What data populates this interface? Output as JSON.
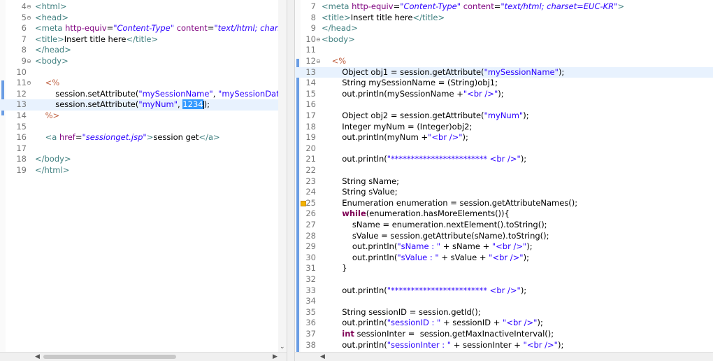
{
  "left_editor": {
    "lines": [
      {
        "num": "4",
        "fold": "⊖",
        "html": "<span class='tag'>&lt;html&gt;</span>"
      },
      {
        "num": "5",
        "fold": "⊖",
        "html": "<span class='tag'>&lt;head&gt;</span>"
      },
      {
        "num": "6",
        "fold": "",
        "html": "<span class='tag'>&lt;meta</span> <span class='attr'>http-equiv</span>=<span class='aval'>\"Content-Type\"</span> <span class='attr'>content</span>=<span class='aval'>\"text/html; charset</span>"
      },
      {
        "num": "7",
        "fold": "",
        "html": "<span class='tag'>&lt;title&gt;</span>Insert title here<span class='tag'>&lt;/title&gt;</span>"
      },
      {
        "num": "8",
        "fold": "",
        "html": "<span class='tag'>&lt;/head&gt;</span>"
      },
      {
        "num": "9",
        "fold": "⊖",
        "html": "<span class='tag'>&lt;body&gt;</span>"
      },
      {
        "num": "10",
        "fold": "",
        "html": ""
      },
      {
        "num": "11",
        "fold": "⊖",
        "html": "    <span class='jsp'>&lt;%</span>"
      },
      {
        "num": "12",
        "fold": "",
        "html": "        session.setAttribute(<span class='str'>\"mySessionName\"</span>, <span class='str'>\"mySessionData\"</span>)"
      },
      {
        "num": "13",
        "fold": "",
        "html": "        session.setAttribute(<span class='str'>\"myNum\"</span>, <span class='sel'>1234</span><span class='cursor'></span>);",
        "highlight": true
      },
      {
        "num": "14",
        "fold": "",
        "html": "    <span class='jsp'>%&gt;</span>"
      },
      {
        "num": "15",
        "fold": "",
        "html": ""
      },
      {
        "num": "16",
        "fold": "",
        "html": "    <span class='tag'>&lt;a</span> <span class='attr'>href</span>=<span class='aval'>\"sessionget.jsp\"</span><span class='tag'>&gt;</span>session get<span class='tag'>&lt;/a&gt;</span>"
      },
      {
        "num": "17",
        "fold": "",
        "html": ""
      },
      {
        "num": "18",
        "fold": "",
        "html": "<span class='tag'>&lt;/body&gt;</span>"
      },
      {
        "num": "19",
        "fold": "",
        "html": "<span class='tag'>&lt;/html&gt;</span>"
      }
    ]
  },
  "right_editor": {
    "lines": [
      {
        "num": "7",
        "fold": "",
        "html": "<span class='tag'>&lt;meta</span> <span class='attr'>http-equiv</span>=<span class='aval'>\"Content-Type\"</span> <span class='attr'>content</span>=<span class='aval'>\"text/html; charset=EUC-KR\"</span><span class='tag'>&gt;</span>"
      },
      {
        "num": "8",
        "fold": "",
        "html": "<span class='tag'>&lt;title&gt;</span>Insert title here<span class='tag'>&lt;/title&gt;</span>"
      },
      {
        "num": "9",
        "fold": "",
        "html": "<span class='tag'>&lt;/head&gt;</span>"
      },
      {
        "num": "10",
        "fold": "⊖",
        "html": "<span class='tag'>&lt;body&gt;</span>"
      },
      {
        "num": "11",
        "fold": "",
        "html": ""
      },
      {
        "num": "12",
        "fold": "⊖",
        "html": "    <span class='jsp'>&lt;%</span>"
      },
      {
        "num": "13",
        "fold": "",
        "html": "        Object obj1 = session.getAttribute(<span class='str'>\"mySessionName\"</span>);",
        "highlight": true
      },
      {
        "num": "14",
        "fold": "",
        "html": "        String mySessionName = (String)obj1;"
      },
      {
        "num": "15",
        "fold": "",
        "html": "        out.println(mySessionName +<span class='str'>\"&lt;br /&gt;\"</span>);"
      },
      {
        "num": "16",
        "fold": "",
        "html": ""
      },
      {
        "num": "17",
        "fold": "",
        "html": "        Object obj2 = session.getAttribute(<span class='str'>\"myNum\"</span>);"
      },
      {
        "num": "18",
        "fold": "",
        "html": "        Integer myNum = (Integer)obj2;"
      },
      {
        "num": "19",
        "fold": "",
        "html": "        out.println(myNum +<span class='str'>\"&lt;br /&gt;\"</span>);"
      },
      {
        "num": "20",
        "fold": "",
        "html": ""
      },
      {
        "num": "21",
        "fold": "",
        "html": "        out.println(<span class='str'>\"************************ &lt;br /&gt;\"</span>);"
      },
      {
        "num": "22",
        "fold": "",
        "html": ""
      },
      {
        "num": "23",
        "fold": "",
        "html": "        String sName;"
      },
      {
        "num": "24",
        "fold": "",
        "html": "        String sValue;"
      },
      {
        "num": "25",
        "fold": "",
        "html": "        Enumeration enumeration = session.getAttributeNames();",
        "warning": true
      },
      {
        "num": "26",
        "fold": "",
        "html": "        <span class='kw'>while</span>(enumeration.hasMoreElements()){"
      },
      {
        "num": "27",
        "fold": "",
        "html": "            sName = enumeration.nextElement().toString();"
      },
      {
        "num": "28",
        "fold": "",
        "html": "            sValue = session.getAttribute(sName).toString();"
      },
      {
        "num": "29",
        "fold": "",
        "html": "            out.println(<span class='str'>\"sName : \"</span> + sName + <span class='str'>\"&lt;br /&gt;\"</span>);"
      },
      {
        "num": "30",
        "fold": "",
        "html": "            out.println(<span class='str'>\"sValue : \"</span> + sValue + <span class='str'>\"&lt;br /&gt;\"</span>);"
      },
      {
        "num": "31",
        "fold": "",
        "html": "        }"
      },
      {
        "num": "32",
        "fold": "",
        "html": ""
      },
      {
        "num": "33",
        "fold": "",
        "html": "        out.println(<span class='str'>\"************************ &lt;br /&gt;\"</span>);"
      },
      {
        "num": "34",
        "fold": "",
        "html": ""
      },
      {
        "num": "35",
        "fold": "",
        "html": "        String sessionID = session.getId();"
      },
      {
        "num": "36",
        "fold": "",
        "html": "        out.println(<span class='str'>\"sessionID : \"</span> + sessionID + <span class='str'>\"&lt;br /&gt;\"</span>);"
      },
      {
        "num": "37",
        "fold": "",
        "html": "        <span class='kw'>int</span> sessionInter =  session.getMaxInactiveInterval();"
      },
      {
        "num": "38",
        "fold": "",
        "html": "        out.println(<span class='str'>\"sessionInter : \"</span> + sessionInter + <span class='str'>\"&lt;br /&gt;\"</span>);"
      }
    ]
  },
  "icons": {
    "scroll_left": "◀",
    "scroll_right": "▶",
    "scroll_down": "⌄"
  },
  "colors": {
    "keyword": "#7f0055",
    "tag": "#3f7f7f",
    "string": "#2a00ff",
    "selection": "#3399ff",
    "current_line": "#e8f2fe"
  }
}
